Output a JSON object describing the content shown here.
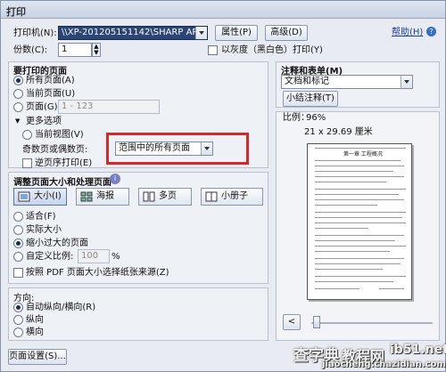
{
  "window": {
    "title": "打印"
  },
  "printer": {
    "label": "打印机(N):",
    "value": "\\\\XP-201205151142\\SHARP AR-18085",
    "properties_button": "属性(P)",
    "advanced_button": "高级(D)",
    "help_link": "帮助(H)"
  },
  "copies": {
    "label": "份数(C):",
    "value": "1"
  },
  "grayscale": {
    "label": "以灰度（黑白色）打印(Y)",
    "checked": false
  },
  "pages_to_print": {
    "heading": "要打印的页面",
    "all_pages": "所有页面(A)",
    "current_page": "当前页面(U)",
    "pages": "页面(G)",
    "pages_value": "1 - 123",
    "more_options": "更多选项",
    "current_view": "当前视图(V)",
    "odd_even_label": "奇数页或偶数页:",
    "odd_even_value": "范围中的所有页面",
    "reverse_label": "逆页序打印(E)"
  },
  "page_sizing": {
    "heading": "调整页面大小和处理页面",
    "tiles": [
      "大小(I)",
      "海报",
      "多页",
      "小册子"
    ],
    "fit": "适合(F)",
    "actual_size": "实际大小",
    "shrink": "缩小过大的页面",
    "custom_scale": "自定义比例:",
    "custom_scale_value": "100",
    "percent": "%",
    "pdf_paper": "按照 PDF 页面大小选择纸张来源(Z)"
  },
  "orientation": {
    "heading": "方向:",
    "auto": "自动纵向/横向(R)",
    "portrait": "纵向",
    "landscape": "横向"
  },
  "page_setup_button": "页面设置(S)...",
  "comments": {
    "heading": "注释和表单(M)",
    "value": "文档和标记",
    "summarize_button": "小结注释(T)"
  },
  "preview": {
    "scale_label": "比例：",
    "scale_value": "96%",
    "size_text": "21 x 29.69 厘米",
    "prev_button": "<",
    "doc_heading": "第一章  工程概况"
  },
  "watermark": {
    "left": "查字典",
    "middle": "教程网",
    "right": "ib51.net",
    "url": "jiaocheng.chazidian.com"
  },
  "colors": {
    "highlight": "#d9262a",
    "accent": "#1a2d5a"
  }
}
